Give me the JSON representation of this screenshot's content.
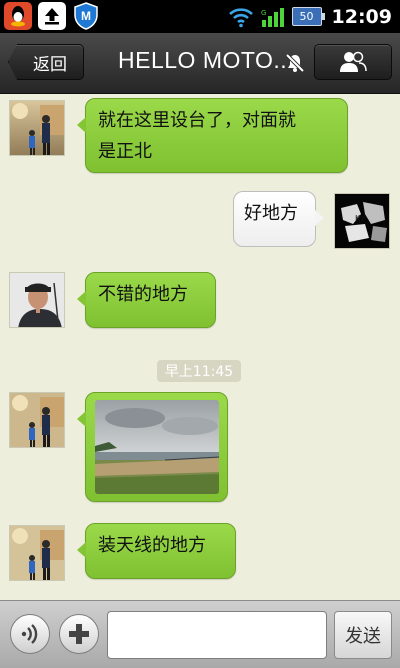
{
  "status_bar": {
    "battery": "50",
    "time": "12:09",
    "icons": [
      "qq-notification-icon",
      "upload-notification-icon",
      "security-shield-icon",
      "wifi-icon",
      "signal-icon",
      "battery-icon"
    ]
  },
  "header": {
    "back_label": "返回",
    "title": "HELLO MOTO...",
    "mute_icon": "mute-icon",
    "contacts_icon": "contacts-icon"
  },
  "messages": [
    {
      "side": "left",
      "type": "text",
      "text_lines": [
        "就在这里设台了，对面就",
        "是正北"
      ]
    },
    {
      "side": "right",
      "type": "text",
      "text": "好地方"
    },
    {
      "side": "left",
      "type": "text",
      "text": "不错的地方"
    },
    {
      "side": "center",
      "type": "timestamp",
      "text": "早上11:45"
    },
    {
      "side": "left",
      "type": "image",
      "image": "seaside-landscape-photo"
    },
    {
      "side": "left",
      "type": "text",
      "text": "装天线的地方"
    }
  ],
  "composer": {
    "voice_icon": "voice-icon",
    "plus_icon": "plus-icon",
    "input_value": "",
    "send_label": "发送"
  },
  "colors": {
    "chat_background": "#eeeedc",
    "incoming_bubble": "#8ccc3e",
    "outgoing_bubble": "#f7f7f7",
    "titlebar": "#333333"
  }
}
